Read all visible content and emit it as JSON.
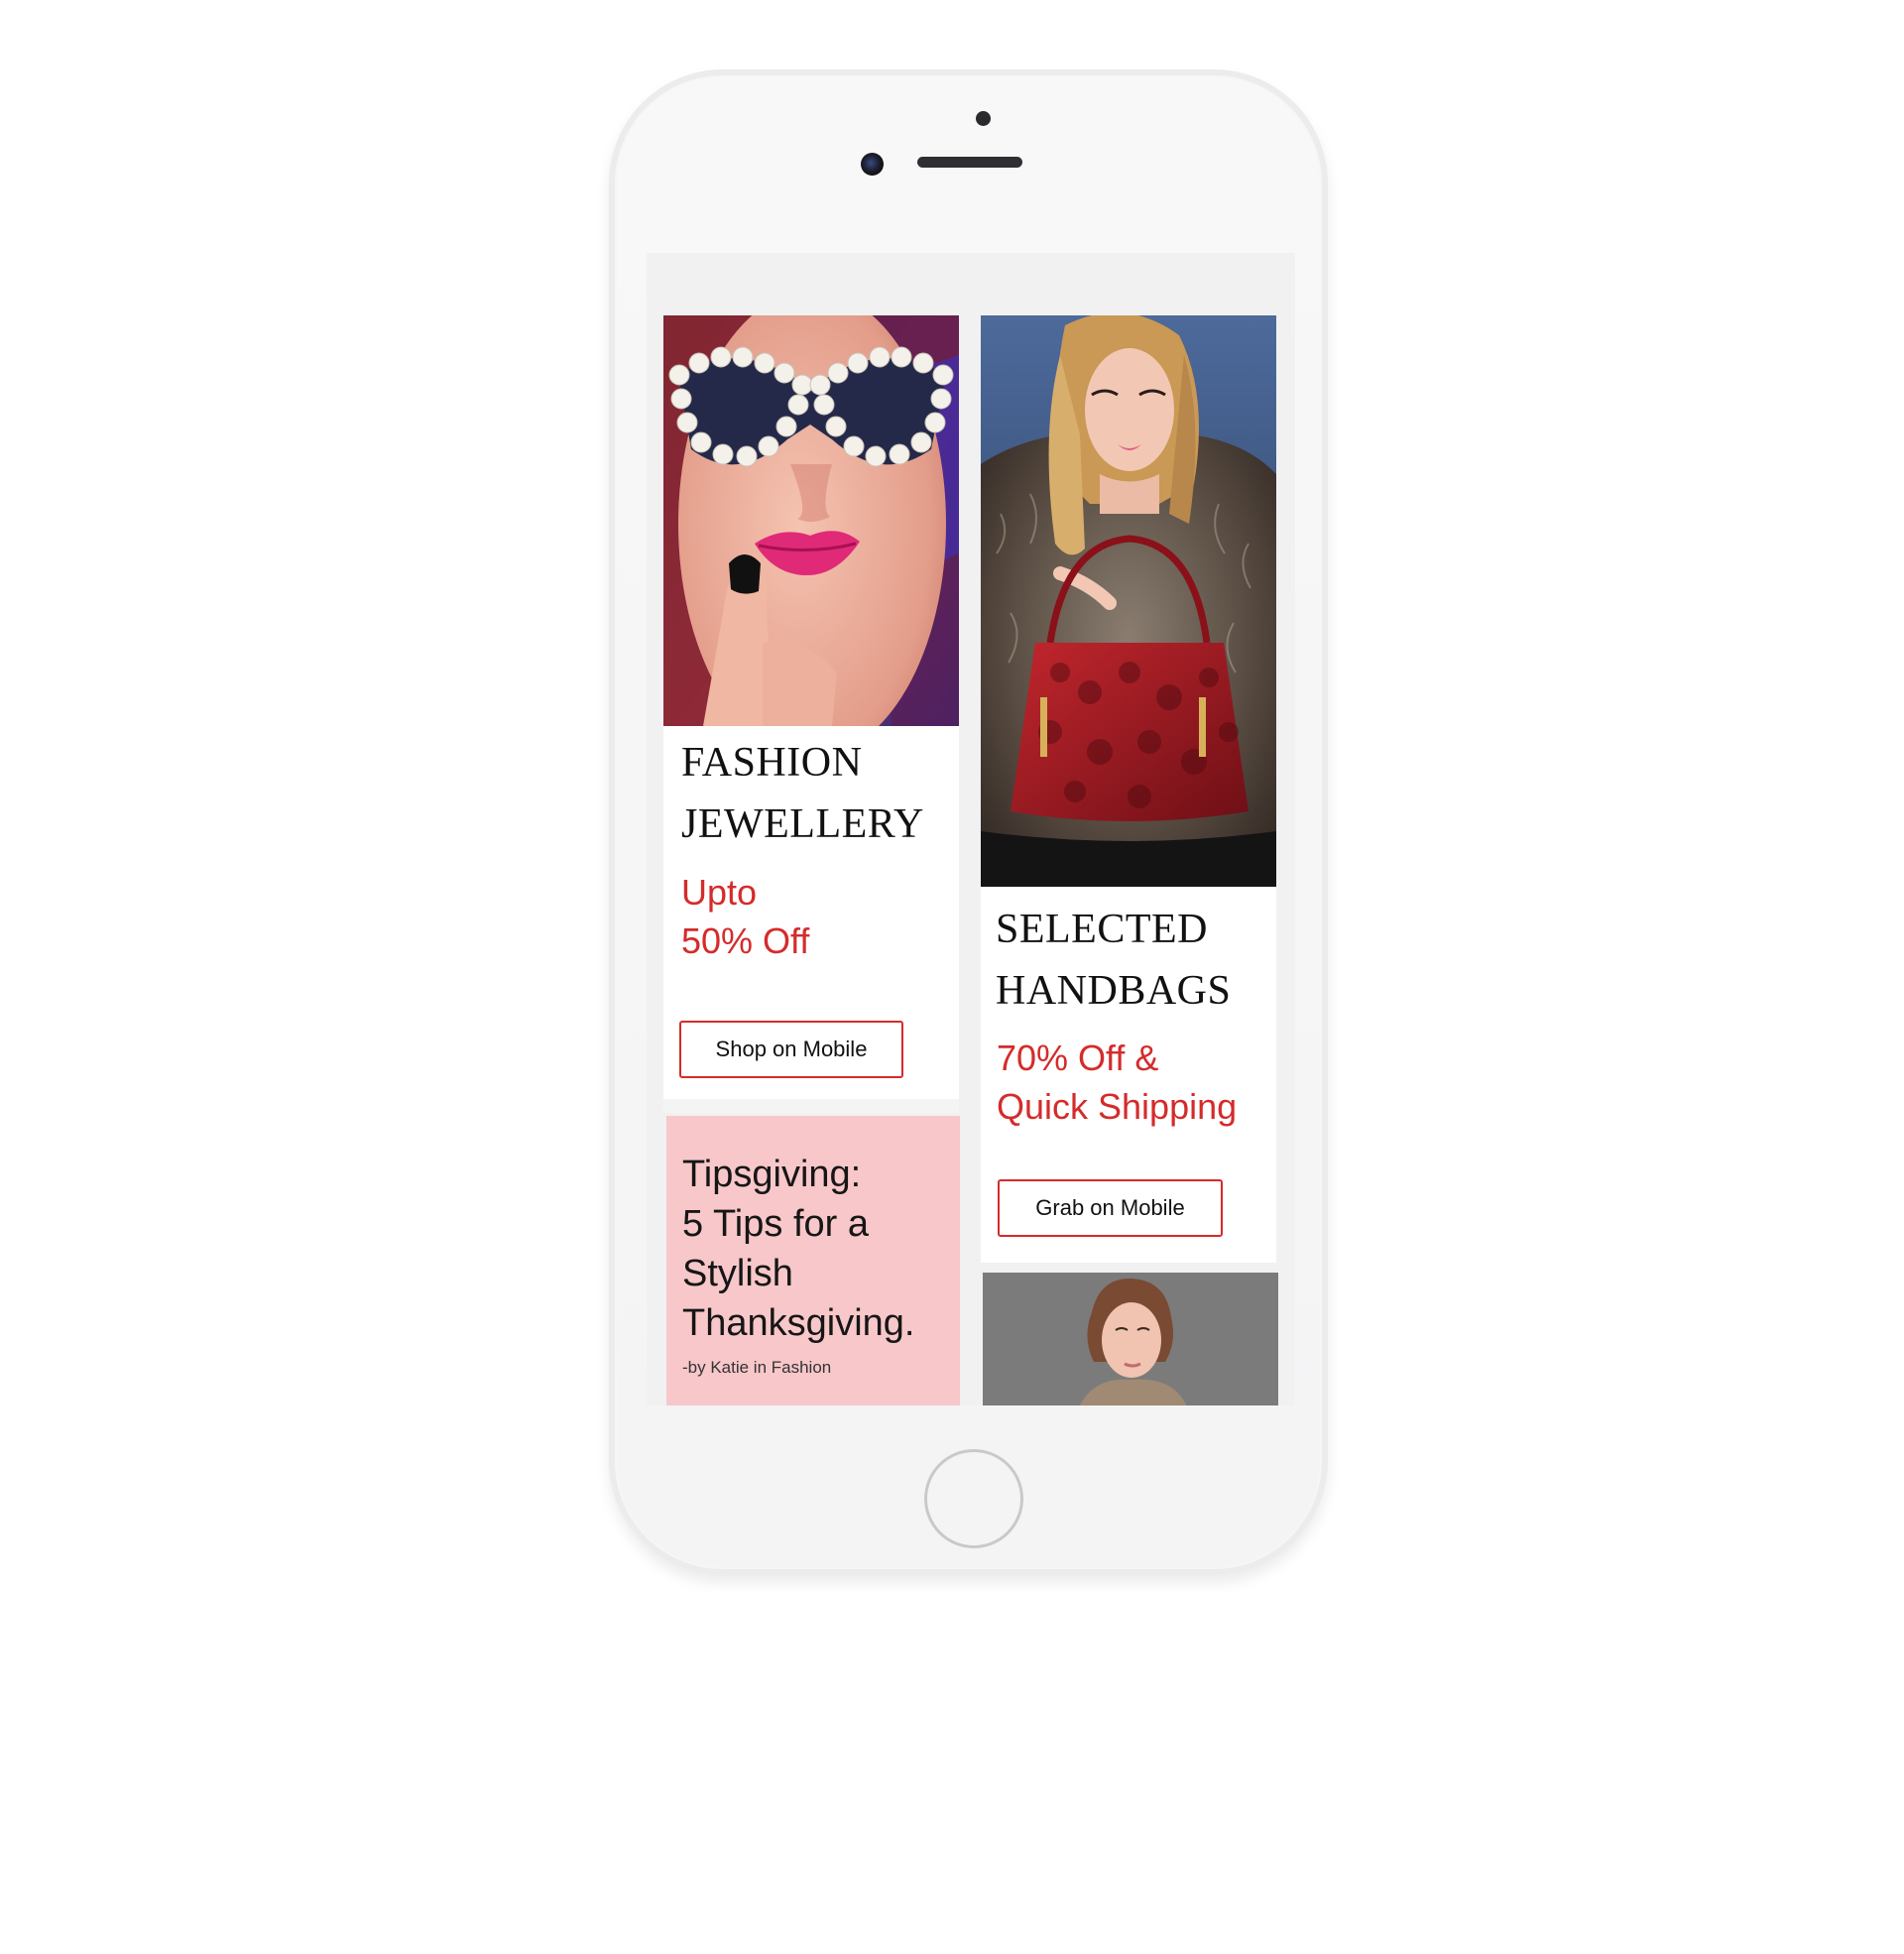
{
  "cards": {
    "jewellery": {
      "title": "FASHION\nJEWELLERY",
      "offer": "Upto\n50% Off",
      "button": "Shop on Mobile"
    },
    "handbags": {
      "title": "SELECTED\nHANDBAGS",
      "offer": "70% Off &\nQuick Shipping",
      "button": "Grab on Mobile"
    },
    "tips": {
      "title": "Tipsgiving:\n5 Tips for a\nStylish\nThanksgiving.",
      "byline": "-by Katie in Fashion"
    }
  },
  "colors": {
    "accent": "#d52b2b",
    "tips_background": "#f8c7ca",
    "screen_background": "#f1f1f1"
  },
  "icons": {
    "home": "home-button-icon",
    "camera": "front-camera-icon"
  }
}
